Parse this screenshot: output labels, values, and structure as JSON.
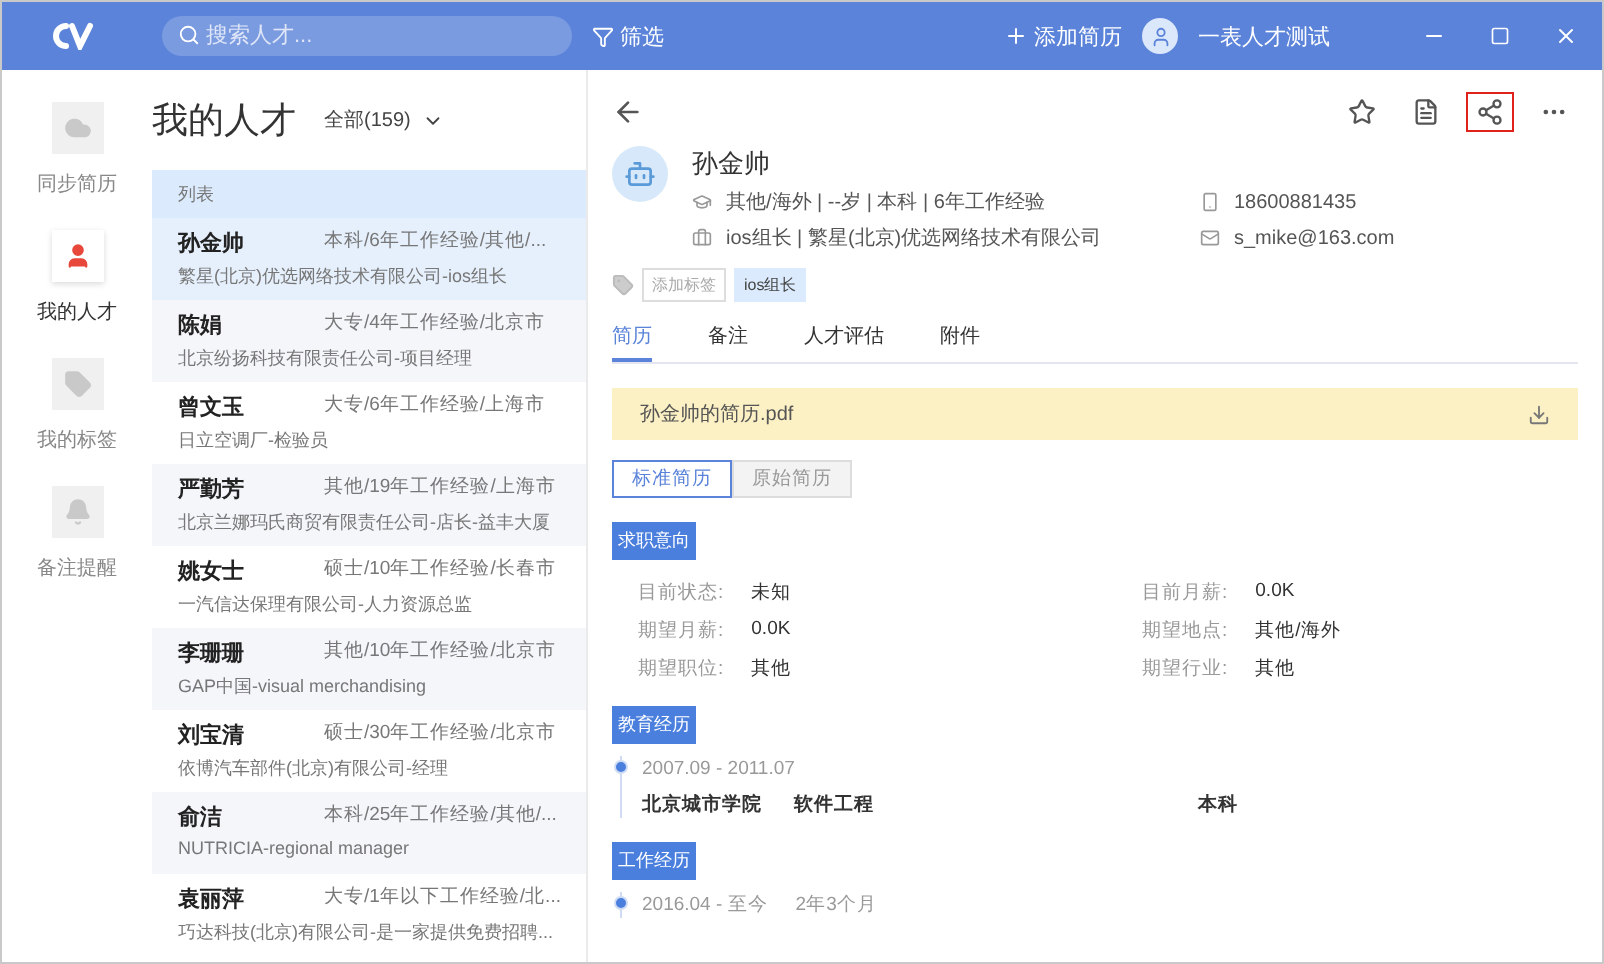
{
  "top_bar": {
    "search": {
      "placeholder": "搜索人才..."
    },
    "filter": "筛选",
    "add_resume": "添加简历",
    "user": "一表人才测试"
  },
  "sidebar": {
    "items": [
      {
        "kind": "cloud",
        "label": "同步简历",
        "selected": false
      },
      {
        "kind": "person",
        "label": "我的人才",
        "selected": true
      },
      {
        "kind": "tag",
        "label": "我的标签",
        "selected": false
      },
      {
        "kind": "bell",
        "label": "备注提醒",
        "selected": false
      }
    ]
  },
  "list": {
    "title": "我的人才",
    "filter": "全部(159)",
    "header": "列表",
    "rows": [
      {
        "name": "孙金帅",
        "summary": "本科/6年工作经验/其他/...",
        "company": "繁星(北京)优选网络技术有限公司-ios组长",
        "selected": true
      },
      {
        "name": "陈娟",
        "summary": "大专/4年工作经验/北京市",
        "company": "北京纷扬科技有限责任公司-项目经理",
        "selected": false
      },
      {
        "name": "曾文玉",
        "summary": "大专/6年工作经验/上海市",
        "company": "日立空调厂-检验员",
        "selected": false
      },
      {
        "name": "严勤芳",
        "summary": "其他/19年工作经验/上海市",
        "company": "北京兰娜玛氏商贸有限责任公司-店长-益丰大厦",
        "selected": false
      },
      {
        "name": "姚女士",
        "summary": "硕士/10年工作经验/长春市",
        "company": "一汽信达保理有限公司-人力资源总监",
        "selected": false
      },
      {
        "name": "李珊珊",
        "summary": "其他/10年工作经验/北京市",
        "company": "GAP中国-visual merchandising",
        "selected": false
      },
      {
        "name": "刘宝清",
        "summary": "硕士/30年工作经验/北京市",
        "company": "依博汽车部件(北京)有限公司-经理",
        "selected": false
      },
      {
        "name": "俞洁",
        "summary": "本科/25年工作经验/其他/...",
        "company": "NUTRICIA-regional manager",
        "selected": false
      },
      {
        "name": "袁丽萍",
        "summary": "大专/1年以下工作经验/北...",
        "company": "巧达科技(北京)有限公司-是一家提供免费招聘...",
        "selected": false
      }
    ]
  },
  "detail": {
    "toolbar": [
      {
        "kind": "star",
        "highlighted": false
      },
      {
        "kind": "notes",
        "highlighted": false
      },
      {
        "kind": "share",
        "highlighted": true
      },
      {
        "kind": "more",
        "highlighted": false
      }
    ],
    "name": "孙金帅",
    "profile": "其他/海外 | --岁 | 本科 | 6年工作经验",
    "job": "ios组长 | 繁星(北京)优选网络技术有限公司",
    "phone": "18600881435",
    "email": "s_mike@163.com",
    "tags": [
      {
        "label": "添加标签",
        "kind": "add"
      },
      {
        "label": "ios组长",
        "kind": "tag"
      }
    ],
    "tabs": [
      {
        "label": "简历",
        "selected": true
      },
      {
        "label": "备注",
        "selected": false
      },
      {
        "label": "人才评估",
        "selected": false
      },
      {
        "label": "附件",
        "selected": false
      }
    ],
    "attachment": "孙金帅的简历.pdf",
    "views": [
      {
        "label": "标准简历",
        "selected": true
      },
      {
        "label": "原始简历",
        "selected": false
      }
    ],
    "intent": {
      "title": "求职意向",
      "fields": [
        {
          "label": "目前状态:",
          "value": "未知"
        },
        {
          "label": "目前月薪:",
          "value": "0.0K"
        },
        {
          "label": "期望月薪:",
          "value": "0.0K"
        },
        {
          "label": "期望地点:",
          "value": "其他/海外"
        },
        {
          "label": "期望职位:",
          "value": "其他"
        },
        {
          "label": "期望行业:",
          "value": "其他"
        }
      ]
    },
    "education": {
      "title": "教育经历",
      "entries": [
        {
          "period": "2007.09 - 2011.07",
          "school": "北京城市学院",
          "major": "软件工程",
          "degree": "本科"
        }
      ]
    },
    "work": {
      "title": "工作经历",
      "entries": [
        {
          "period": "2016.04 - 至今",
          "duration": "2年3个月"
        }
      ]
    }
  }
}
